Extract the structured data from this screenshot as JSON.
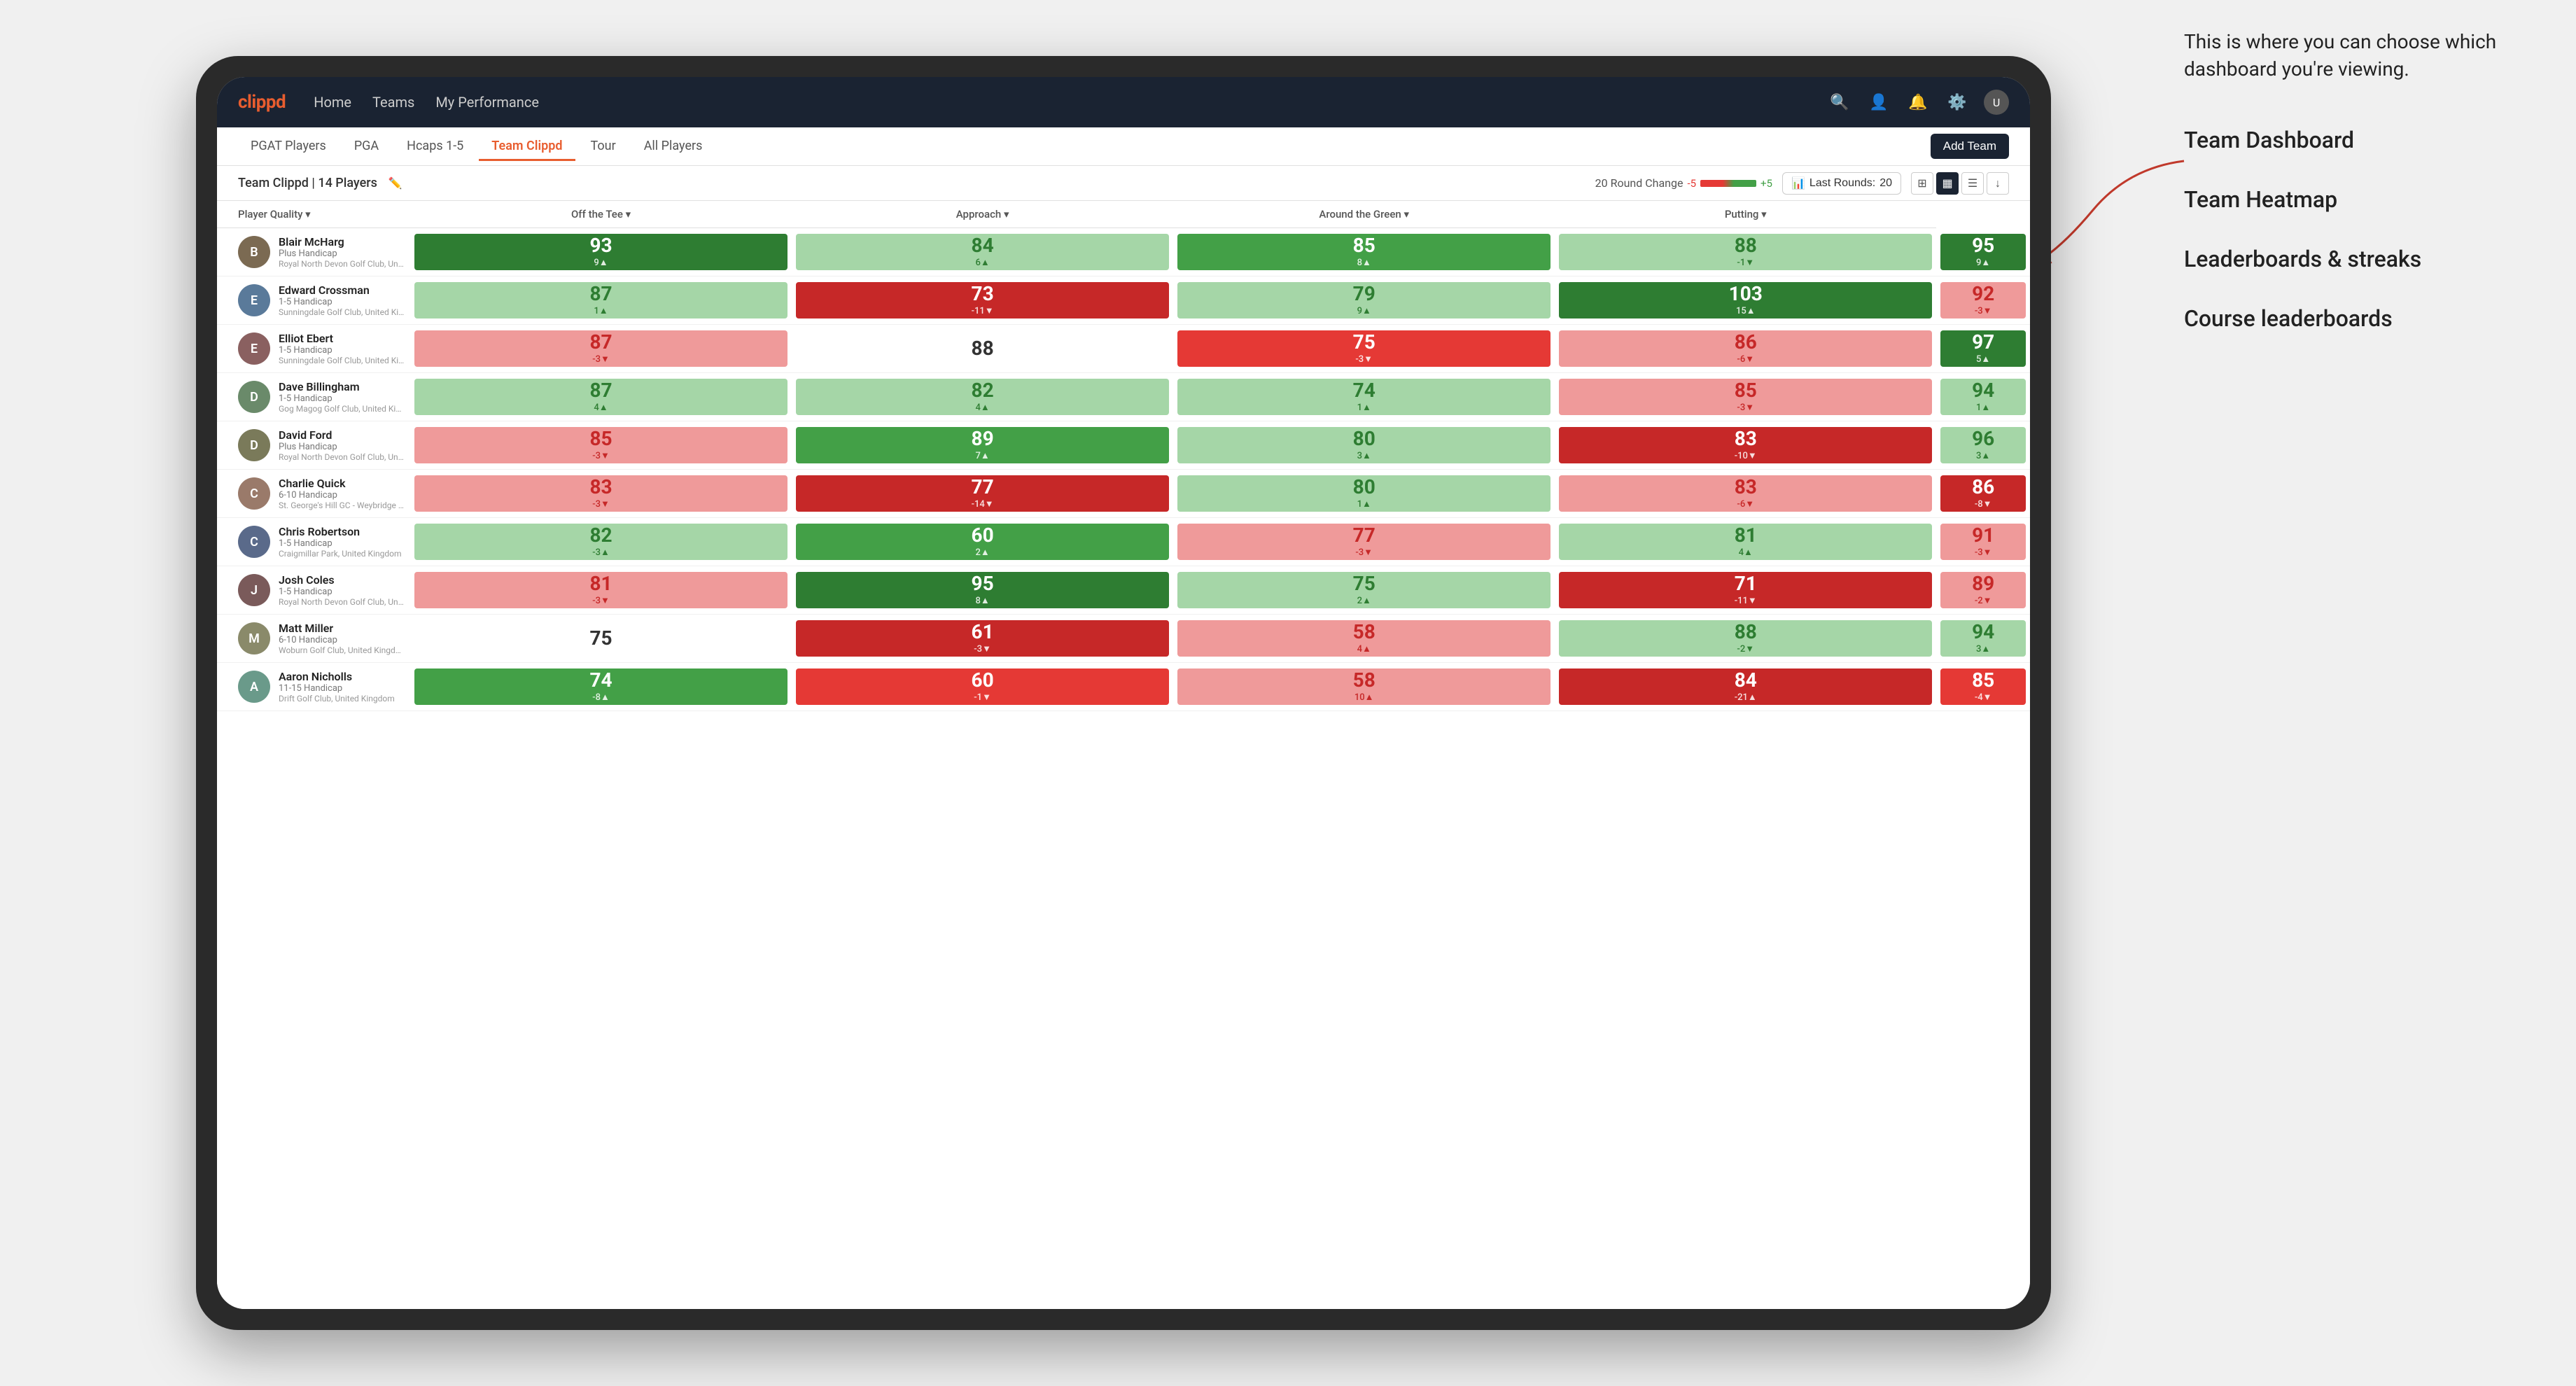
{
  "annotation": {
    "intro": "This is where you can choose which dashboard you're viewing.",
    "items": [
      "Team Dashboard",
      "Team Heatmap",
      "Leaderboards & streaks",
      "Course leaderboards"
    ]
  },
  "navbar": {
    "logo": "clippd",
    "nav_items": [
      "Home",
      "Teams",
      "My Performance"
    ],
    "icons": [
      "search",
      "user",
      "bell",
      "settings",
      "avatar"
    ]
  },
  "subnav": {
    "tabs": [
      "PGAT Players",
      "PGA",
      "Hcaps 1-5",
      "Team Clippd",
      "Tour",
      "All Players"
    ],
    "active_tab": "Team Clippd",
    "add_team_label": "Add Team"
  },
  "teambar": {
    "title": "Team Clippd | 14 Players",
    "round_change_label": "20 Round Change",
    "rc_neg": "-5",
    "rc_pos": "+5",
    "last_rounds_label": "Last Rounds:",
    "last_rounds_value": "20"
  },
  "table": {
    "columns": [
      "Player Quality ▾",
      "Off the Tee ▾",
      "Approach ▾",
      "Around the Green ▾",
      "Putting ▾"
    ],
    "rows": [
      {
        "name": "Blair McHarg",
        "handicap": "Plus Handicap",
        "club": "Royal North Devon Golf Club, United Kingdom",
        "avatar_color": "#7b6a52",
        "scores": [
          {
            "value": "93",
            "change": "9▲",
            "dir": "up",
            "color": "green-dark"
          },
          {
            "value": "84",
            "change": "6▲",
            "dir": "up",
            "color": "green-light"
          },
          {
            "value": "85",
            "change": "8▲",
            "dir": "up",
            "color": "green-mid"
          },
          {
            "value": "88",
            "change": "-1▼",
            "dir": "down",
            "color": "green-light"
          },
          {
            "value": "95",
            "change": "9▲",
            "dir": "up",
            "color": "green-dark"
          }
        ]
      },
      {
        "name": "Edward Crossman",
        "handicap": "1-5 Handicap",
        "club": "Sunningdale Golf Club, United Kingdom",
        "avatar_color": "#5a7a9a",
        "scores": [
          {
            "value": "87",
            "change": "1▲",
            "dir": "up",
            "color": "green-light"
          },
          {
            "value": "73",
            "change": "-11▼",
            "dir": "down",
            "color": "red-dark"
          },
          {
            "value": "79",
            "change": "9▲",
            "dir": "up",
            "color": "green-light"
          },
          {
            "value": "103",
            "change": "15▲",
            "dir": "up",
            "color": "green-dark"
          },
          {
            "value": "92",
            "change": "-3▼",
            "dir": "down",
            "color": "red-light"
          }
        ]
      },
      {
        "name": "Elliot Ebert",
        "handicap": "1-5 Handicap",
        "club": "Sunningdale Golf Club, United Kingdom",
        "avatar_color": "#8a6060",
        "scores": [
          {
            "value": "87",
            "change": "-3▼",
            "dir": "down",
            "color": "red-light"
          },
          {
            "value": "88",
            "change": "",
            "dir": "neutral",
            "color": "neutral-bg"
          },
          {
            "value": "75",
            "change": "-3▼",
            "dir": "down",
            "color": "red-mid"
          },
          {
            "value": "86",
            "change": "-6▼",
            "dir": "down",
            "color": "red-light"
          },
          {
            "value": "97",
            "change": "5▲",
            "dir": "up",
            "color": "green-dark"
          }
        ]
      },
      {
        "name": "Dave Billingham",
        "handicap": "1-5 Handicap",
        "club": "Gog Magog Golf Club, United Kingdom",
        "avatar_color": "#6a8a6a",
        "scores": [
          {
            "value": "87",
            "change": "4▲",
            "dir": "up",
            "color": "green-light"
          },
          {
            "value": "82",
            "change": "4▲",
            "dir": "up",
            "color": "green-light"
          },
          {
            "value": "74",
            "change": "1▲",
            "dir": "up",
            "color": "green-light"
          },
          {
            "value": "85",
            "change": "-3▼",
            "dir": "down",
            "color": "red-light"
          },
          {
            "value": "94",
            "change": "1▲",
            "dir": "up",
            "color": "green-light"
          }
        ]
      },
      {
        "name": "David Ford",
        "handicap": "Plus Handicap",
        "club": "Royal North Devon Golf Club, United Kingdom",
        "avatar_color": "#7a7a5a",
        "scores": [
          {
            "value": "85",
            "change": "-3▼",
            "dir": "down",
            "color": "red-light"
          },
          {
            "value": "89",
            "change": "7▲",
            "dir": "up",
            "color": "green-mid"
          },
          {
            "value": "80",
            "change": "3▲",
            "dir": "up",
            "color": "green-light"
          },
          {
            "value": "83",
            "change": "-10▼",
            "dir": "down",
            "color": "red-dark"
          },
          {
            "value": "96",
            "change": "3▲",
            "dir": "up",
            "color": "green-light"
          }
        ]
      },
      {
        "name": "Charlie Quick",
        "handicap": "6-10 Handicap",
        "club": "St. George's Hill GC - Weybridge - Surrey, Uni...",
        "avatar_color": "#9a7a6a",
        "scores": [
          {
            "value": "83",
            "change": "-3▼",
            "dir": "down",
            "color": "red-light"
          },
          {
            "value": "77",
            "change": "-14▼",
            "dir": "down",
            "color": "red-dark"
          },
          {
            "value": "80",
            "change": "1▲",
            "dir": "up",
            "color": "green-light"
          },
          {
            "value": "83",
            "change": "-6▼",
            "dir": "down",
            "color": "red-light"
          },
          {
            "value": "86",
            "change": "-8▼",
            "dir": "down",
            "color": "red-dark"
          }
        ]
      },
      {
        "name": "Chris Robertson",
        "handicap": "1-5 Handicap",
        "club": "Craigmillar Park, United Kingdom",
        "avatar_color": "#5a6a8a",
        "scores": [
          {
            "value": "82",
            "change": "-3▲",
            "dir": "up",
            "color": "green-light"
          },
          {
            "value": "60",
            "change": "2▲",
            "dir": "up",
            "color": "green-mid"
          },
          {
            "value": "77",
            "change": "-3▼",
            "dir": "down",
            "color": "red-light"
          },
          {
            "value": "81",
            "change": "4▲",
            "dir": "up",
            "color": "green-light"
          },
          {
            "value": "91",
            "change": "-3▼",
            "dir": "down",
            "color": "red-light"
          }
        ]
      },
      {
        "name": "Josh Coles",
        "handicap": "1-5 Handicap",
        "club": "Royal North Devon Golf Club, United Kingdom",
        "avatar_color": "#7a5a5a",
        "scores": [
          {
            "value": "81",
            "change": "-3▼",
            "dir": "down",
            "color": "red-light"
          },
          {
            "value": "95",
            "change": "8▲",
            "dir": "up",
            "color": "green-dark"
          },
          {
            "value": "75",
            "change": "2▲",
            "dir": "up",
            "color": "green-light"
          },
          {
            "value": "71",
            "change": "-11▼",
            "dir": "down",
            "color": "red-dark"
          },
          {
            "value": "89",
            "change": "-2▼",
            "dir": "down",
            "color": "red-light"
          }
        ]
      },
      {
        "name": "Matt Miller",
        "handicap": "6-10 Handicap",
        "club": "Woburn Golf Club, United Kingdom",
        "avatar_color": "#8a8a6a",
        "scores": [
          {
            "value": "75",
            "change": "",
            "dir": "neutral",
            "color": "neutral-bg"
          },
          {
            "value": "61",
            "change": "-3▼",
            "dir": "down",
            "color": "red-dark"
          },
          {
            "value": "58",
            "change": "4▲",
            "dir": "up",
            "color": "red-light"
          },
          {
            "value": "88",
            "change": "-2▼",
            "dir": "down",
            "color": "green-light"
          },
          {
            "value": "94",
            "change": "3▲",
            "dir": "up",
            "color": "green-light"
          }
        ]
      },
      {
        "name": "Aaron Nicholls",
        "handicap": "11-15 Handicap",
        "club": "Drift Golf Club, United Kingdom",
        "avatar_color": "#6a9a8a",
        "scores": [
          {
            "value": "74",
            "change": "-8▲",
            "dir": "up",
            "color": "green-mid"
          },
          {
            "value": "60",
            "change": "-1▼",
            "dir": "down",
            "color": "red-mid"
          },
          {
            "value": "58",
            "change": "10▲",
            "dir": "up",
            "color": "red-light"
          },
          {
            "value": "84",
            "change": "-21▲",
            "dir": "up",
            "color": "red-dark"
          },
          {
            "value": "85",
            "change": "-4▼",
            "dir": "down",
            "color": "red-mid"
          }
        ]
      }
    ]
  }
}
